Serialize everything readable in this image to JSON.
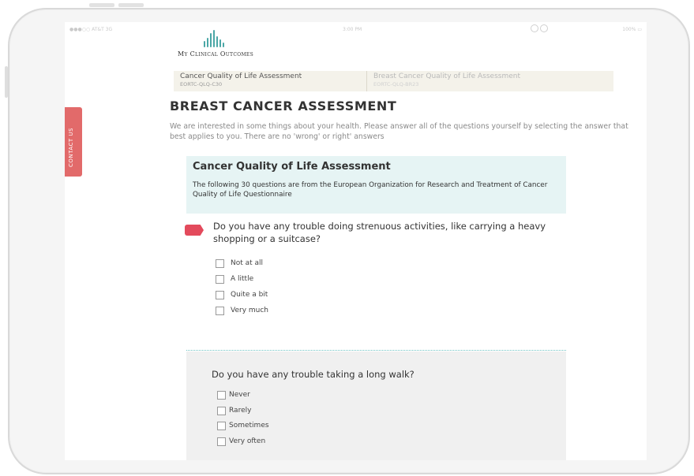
{
  "status_bar": {
    "left": "●●●○○ AT&T 3G",
    "time": "3:00 PM",
    "right": "100% ▭"
  },
  "brand": {
    "name": "My Clinical Outcomes",
    "accent": "#4aa7a6"
  },
  "breadcrumb": [
    {
      "title": "Cancer Quality of Life Assessment",
      "code": "EORTC-QLQ-C30"
    },
    {
      "title": "Breast Cancer Quality of Life Assessment",
      "code": "EORTC-QLQ-BR23"
    }
  ],
  "page": {
    "title": "BREAST CANCER ASSESSMENT",
    "intro": "We are interested in some things about your health. Please answer all of the questions yourself by selecting the answer that best applies to you. There are no 'wrong' or right' answers"
  },
  "contact_tab": {
    "label": "CONTACT US",
    "color": "#e26a6a"
  },
  "section": {
    "title": "Cancer Quality of Life Assessment",
    "description": "The following 30 questions are from the European Organization for Research and Treatment of Cancer Quality of Life Questionnaire"
  },
  "questions": [
    {
      "text": "Do you have any trouble doing strenuous activities, like carrying a heavy shopping or a suitcase?",
      "options": [
        "Not at all",
        "A little",
        "Quite a bit",
        "Very much"
      ],
      "marker_color": "#e34a5c"
    },
    {
      "text": "Do you have any trouble taking a long walk?",
      "options": [
        "Never",
        "Rarely",
        "Sometimes",
        "Very often"
      ]
    }
  ]
}
